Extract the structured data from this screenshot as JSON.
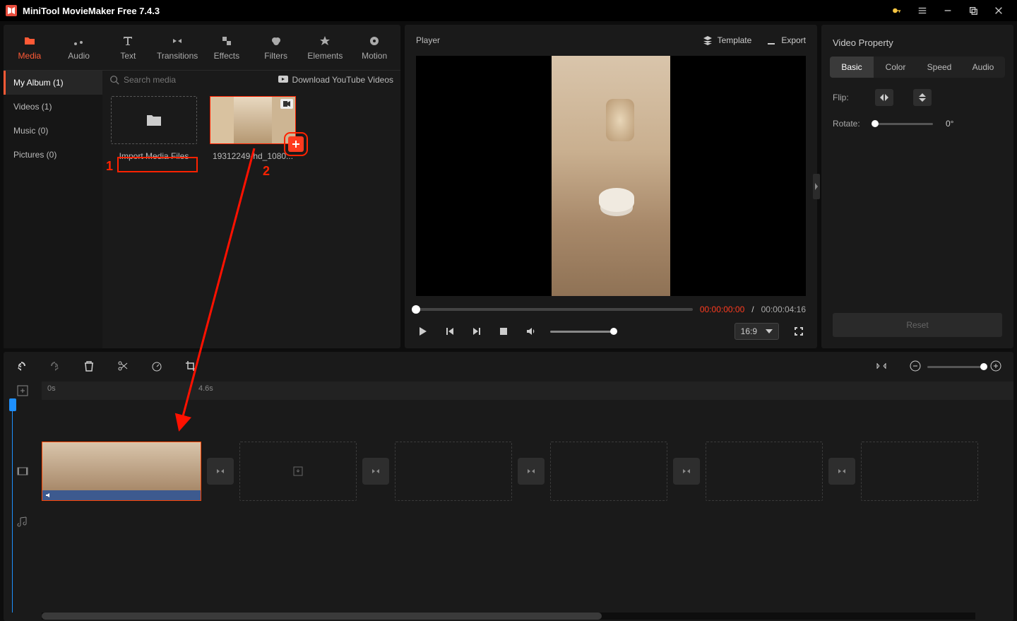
{
  "app": {
    "title": "MiniTool MovieMaker Free 7.4.3"
  },
  "topTabs": [
    {
      "label": "Media",
      "active": true
    },
    {
      "label": "Audio"
    },
    {
      "label": "Text"
    },
    {
      "label": "Transitions"
    },
    {
      "label": "Effects"
    },
    {
      "label": "Filters"
    },
    {
      "label": "Elements"
    },
    {
      "label": "Motion"
    }
  ],
  "sidebar": [
    {
      "label": "My Album (1)",
      "active": true
    },
    {
      "label": "Videos (1)"
    },
    {
      "label": "Music (0)"
    },
    {
      "label": "Pictures (0)"
    }
  ],
  "mediaArea": {
    "searchPlaceholder": "Search media",
    "downloadLabel": "Download YouTube Videos",
    "importLabel": "Import Media Files",
    "clipName": "19312249-hd_1080..."
  },
  "player": {
    "title": "Player",
    "templateLabel": "Template",
    "exportLabel": "Export",
    "currentTime": "00:00:00:00",
    "sep": " / ",
    "totalTime": "00:00:04:16",
    "aspect": "16:9"
  },
  "property": {
    "title": "Video Property",
    "tabs": [
      "Basic",
      "Color",
      "Speed",
      "Audio"
    ],
    "activeTab": 0,
    "flipLabel": "Flip:",
    "rotateLabel": "Rotate:",
    "rotateValue": "0°",
    "resetLabel": "Reset"
  },
  "timeline": {
    "ticks": [
      {
        "pos": 12,
        "label": "0s"
      },
      {
        "pos": 228,
        "label": "4.6s"
      }
    ]
  },
  "annotations": {
    "num1": "1",
    "num2": "2"
  }
}
